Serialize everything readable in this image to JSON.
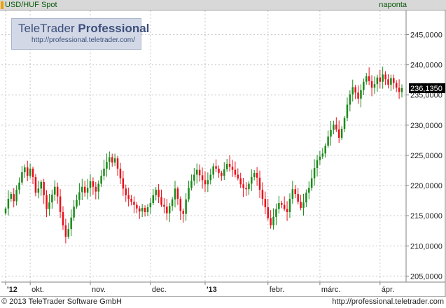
{
  "header": {
    "title": "USD/HUF Spot",
    "period": "naponta"
  },
  "footer": {
    "copyright": "© 2013 TeleTrader Software GmbH",
    "url": "http://professional.teletrader.com"
  },
  "logo": {
    "name_light": "TeleTrader",
    "name_bold": "Professional",
    "url": "http://professional.teletrader.com/"
  },
  "colors": {
    "up": "#1a8a1a",
    "down": "#e8101a",
    "grid": "#c8c8c8",
    "axis": "#808080",
    "last_price_box": "#000000",
    "header_accent": "#f0a000"
  },
  "chart_data": {
    "type": "candlestick",
    "title": "USD/HUF Spot",
    "frequency": "naponta",
    "y_axis_side": "right",
    "ylim": [
      204,
      249
    ],
    "yticks": [
      "205,0000",
      "210,0000",
      "215,0000",
      "220,0000",
      "225,0000",
      "230,0000",
      "235,0000",
      "240,0000",
      "245,0000"
    ],
    "ytick_values": [
      205,
      210,
      215,
      220,
      225,
      230,
      235,
      240,
      245
    ],
    "last_price_label": "236,1350",
    "last_price": 236.135,
    "grid": true,
    "x_axis_labels": [
      {
        "label": "'12",
        "bold": true,
        "index": 0
      },
      {
        "label": "okt.",
        "bold": false,
        "index": 9
      },
      {
        "label": "nov.",
        "bold": false,
        "index": 31
      },
      {
        "label": "dec.",
        "bold": false,
        "index": 53
      },
      {
        "label": "'13",
        "bold": true,
        "index": 73
      },
      {
        "label": "febr.",
        "bold": false,
        "index": 96
      },
      {
        "label": "márc.",
        "bold": false,
        "index": 115
      },
      {
        "label": "ápr.",
        "bold": false,
        "index": 137
      }
    ],
    "closes": [
      216.2,
      217.8,
      218.6,
      217.4,
      219.3,
      220.5,
      222.2,
      223.0,
      221.6,
      222.8,
      221.4,
      218.8,
      219.5,
      220.6,
      218.4,
      216.1,
      217.2,
      218.5,
      219.8,
      218.2,
      215.6,
      213.4,
      211.5,
      212.8,
      214.7,
      216.5,
      217.6,
      218.9,
      219.8,
      218.8,
      219.6,
      220.7,
      219.8,
      219.0,
      220.3,
      221.6,
      222.8,
      223.9,
      224.7,
      223.8,
      224.5,
      222.8,
      221.2,
      219.5,
      218.4,
      217.8,
      217.3,
      216.8,
      216.2,
      215.7,
      216.3,
      215.6,
      216.4,
      217.1,
      218.4,
      219.3,
      218.1,
      216.8,
      216.5,
      215.4,
      216.6,
      217.7,
      219.5,
      217.8,
      215.8,
      215.3,
      217.7,
      219.6,
      220.8,
      221.8,
      222.6,
      221.7,
      220.9,
      220.2,
      220.9,
      221.8,
      223.2,
      222.8,
      222.1,
      221.6,
      222.7,
      223.6,
      223.1,
      222.6,
      221.8,
      221.2,
      220.2,
      219.6,
      219.4,
      220.3,
      221.4,
      222.1,
      221.3,
      219.3,
      217.8,
      216.4,
      214.6,
      213.4,
      214.8,
      216.1,
      217.1,
      216.8,
      216.1,
      215.6,
      217.8,
      219.4,
      218.6,
      217.3,
      216.3,
      217.2,
      218.8,
      219.6,
      221.2,
      222.9,
      224.2,
      224.8,
      225.3,
      226.6,
      228.1,
      229.2,
      230.1,
      229.3,
      227.9,
      229.4,
      231.2,
      233.4,
      235.1,
      236.3,
      235.4,
      234.4,
      235.8,
      237.2,
      238.1,
      237.3,
      236.2,
      236.8,
      237.9,
      237.2,
      238.4,
      237.6,
      236.7,
      237.8,
      237.0,
      236.2,
      235.5,
      236.135
    ],
    "candle_color_rule": "up (green) when close >= previous close, down (red) otherwise"
  }
}
